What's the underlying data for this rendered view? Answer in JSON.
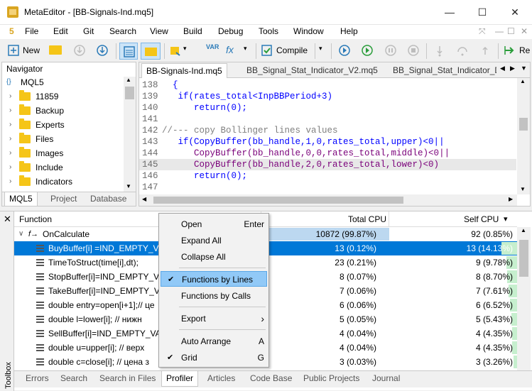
{
  "window": {
    "title": "MetaEditor - [BB-Signals-Ind.mq5]",
    "minimize": "—",
    "maximize": "☐",
    "close": "✕"
  },
  "menubar": {
    "app_glyph": "5",
    "items": [
      "File",
      "Edit",
      "Git",
      "Search",
      "View",
      "Build",
      "Debug",
      "Tools",
      "Window",
      "Help"
    ],
    "mdi_controls": [
      "⤧",
      "—",
      "☐",
      "✕"
    ]
  },
  "toolbar": {
    "new_label": "New",
    "compile_label": "Compile",
    "var_label": "VAR",
    "fx_label": "fx",
    "re_label": "Re"
  },
  "navigator": {
    "title": "Navigator",
    "root": "MQL5",
    "items": [
      "11859",
      "Backup",
      "Experts",
      "Files",
      "Images",
      "Include",
      "Indicators"
    ],
    "tabs": [
      "MQL5",
      "Project",
      "Database"
    ]
  },
  "editor": {
    "tabs": [
      "BB-Signals-Ind.mq5",
      "BB_Signal_Stat_Indicator_V2.mq5",
      "BB_Signal_Stat_Indicator_D"
    ],
    "lines": [
      {
        "n": "138",
        "t": "  {"
      },
      {
        "n": "139",
        "t": "   if(rates_total<InpBBPeriod+3)"
      },
      {
        "n": "140",
        "t": "      return(0);"
      },
      {
        "n": "141",
        "t": ""
      },
      {
        "n": "142",
        "t": "//--- copy Bollinger lines values"
      },
      {
        "n": "143",
        "t": "   if(CopyBuffer(bb_handle,1,0,rates_total,upper)<0||"
      },
      {
        "n": "144",
        "t": "      CopyBuffer(bb_handle,0,0,rates_total,middle)<0||"
      },
      {
        "n": "145",
        "t": "      CopyBuffer(bb_handle,2,0,rates_total,lower)<0)"
      },
      {
        "n": "146",
        "t": "      return(0);"
      },
      {
        "n": "147",
        "t": ""
      }
    ]
  },
  "profiler": {
    "col_function": "Function",
    "col_total": "Total CPU",
    "col_self": "Self CPU",
    "sort_arrow": "▾",
    "root": {
      "name": "OnCalculate",
      "total": "10872 (99.87%)",
      "self": "92 (0.85%)"
    },
    "rows": [
      {
        "name": "BuyBuffer[i] =IND_EMPTY_VA",
        "total": "13 (0.12%)",
        "self": "13 (14.13%)",
        "pct": 14.13
      },
      {
        "name": "TimeToStruct(time[i],dt);",
        "total": "23 (0.21%)",
        "self": "9 (9.78%)",
        "pct": 9.78
      },
      {
        "name": "StopBuffer[i]=IND_EMPTY_VA",
        "total": "8 (0.07%)",
        "self": "8 (8.70%)",
        "pct": 8.7
      },
      {
        "name": "TakeBuffer[i]=IND_EMPTY_VA",
        "total": "7 (0.06%)",
        "self": "7 (7.61%)",
        "pct": 7.61
      },
      {
        "name": "double entry=open[i+1];// це",
        "total": "6 (0.06%)",
        "self": "6 (6.52%)",
        "pct": 6.52
      },
      {
        "name": "double l=lower[i];    // нижн",
        "total": "5 (0.05%)",
        "self": "5 (5.43%)",
        "pct": 5.43
      },
      {
        "name": "SellBuffer[i]=IND_EMPTY_VAL",
        "total": "4 (0.04%)",
        "self": "4 (4.35%)",
        "pct": 4.35
      },
      {
        "name": "double u=upper[i];    // верх",
        "total": "4 (0.04%)",
        "self": "4 (4.35%)",
        "pct": 4.35
      },
      {
        "name": "double c=close[i];    // цена з",
        "total": "3 (0.03%)",
        "self": "3 (3.26%)",
        "pct": 3.26
      }
    ]
  },
  "toolbox": {
    "label": "Toolbox",
    "close": "✕",
    "tabs": [
      "Errors",
      "Search",
      "Search in Files",
      "Profiler",
      "Articles",
      "Code Base",
      "Public Projects",
      "Journal"
    ],
    "active_tab": "Profiler"
  },
  "context_menu": {
    "items": [
      {
        "label": "Open",
        "shortcut": "Enter"
      },
      {
        "label": "Expand All",
        "shortcut": ""
      },
      {
        "label": "Collapse All",
        "shortcut": ""
      },
      {
        "label": "Functions by Lines",
        "shortcut": "",
        "checked": true
      },
      {
        "label": "Functions by Calls",
        "shortcut": ""
      },
      {
        "label": "Export",
        "shortcut": "›"
      },
      {
        "label": "Auto Arrange",
        "shortcut": "A"
      },
      {
        "label": "Grid",
        "shortcut": "G",
        "checked": true
      }
    ],
    "check_glyph": "✔"
  },
  "colors": {
    "selection": "#0078d7",
    "menu_highlight": "#91c9f7",
    "self_bar": "#c6efce",
    "root_bar": "#bcd8f0"
  }
}
